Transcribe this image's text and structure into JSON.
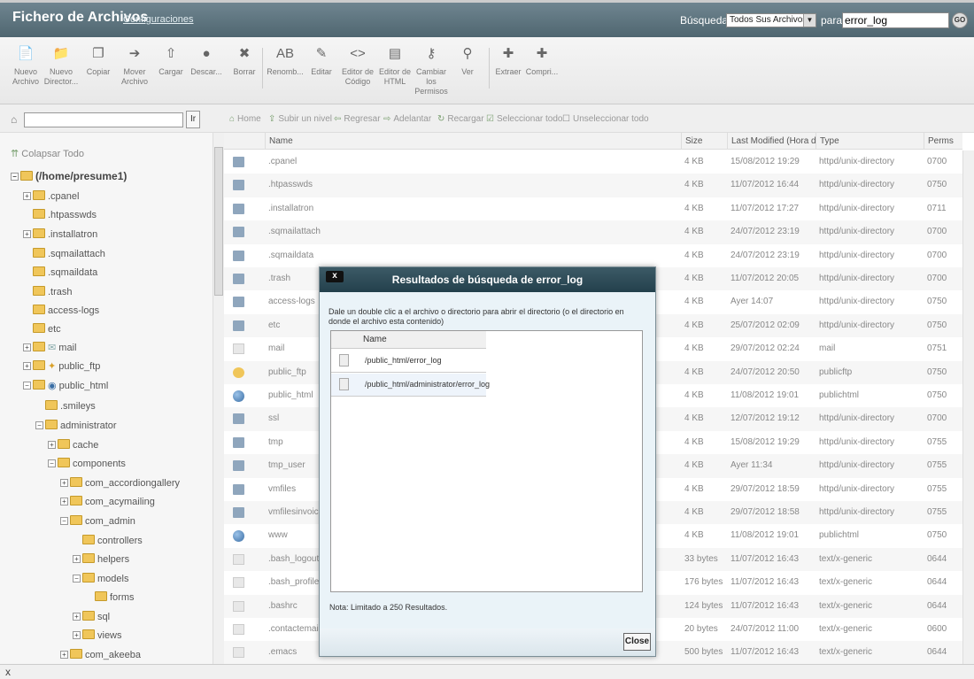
{
  "header": {
    "title": "Fichero de Archivos",
    "config_link": "Configuraciones",
    "search_label": "Búsqueda",
    "search_scope": "Todos Sus Archivos",
    "para_label": "para",
    "search_value": "error_log",
    "go_label": "GO"
  },
  "toolbar": {
    "items": [
      {
        "label": "Nuevo\nArchivo"
      },
      {
        "label": "Nuevo\nDirector..."
      },
      {
        "label": "Copiar"
      },
      {
        "label": "Mover\nArchivo"
      },
      {
        "label": "Cargar"
      },
      {
        "label": "Descar..."
      },
      {
        "label": "Borrar"
      },
      {
        "label": "Renomb..."
      },
      {
        "label": "Editar"
      },
      {
        "label": "Editor de\nCódigo"
      },
      {
        "label": "Editor de\nHTML"
      },
      {
        "label": "Cambiar\nlos\nPermisos"
      },
      {
        "label": "Ver"
      },
      {
        "label": "Extraer"
      },
      {
        "label": "Compri..."
      }
    ]
  },
  "pathbar": {
    "go_label": "Ir",
    "home": "Home",
    "up": "Subir un nivel",
    "back": "Regresar",
    "forward": "Adelantar",
    "reload": "Recargar",
    "select_all": "Seleccionar todo",
    "unselect_all": "Unseleccionar todo"
  },
  "tree": {
    "collapse": "Colapsar Todo",
    "root": "(/home/presume1)",
    "nodes": [
      ".cpanel",
      ".htpasswds",
      ".installatron",
      ".sqmailattach",
      ".sqmaildata",
      ".trash",
      "access-logs",
      "etc",
      "mail",
      "public_ftp",
      "public_html",
      ".smileys",
      "administrator",
      "cache",
      "components",
      "com_accordiongallery",
      "com_acymailing",
      "com_admin",
      "controllers",
      "helpers",
      "models",
      "forms",
      "sql",
      "views",
      "com_akeeba"
    ]
  },
  "table": {
    "columns": [
      "Name",
      "Size",
      "Last Modified (Hora de ve",
      "Type",
      "Perms"
    ],
    "rows": [
      {
        "name": ".cpanel",
        "size": "4 KB",
        "modified": "15/08/2012 19:29",
        "type": "httpd/unix-directory",
        "perms": "0700"
      },
      {
        "name": ".htpasswds",
        "size": "4 KB",
        "modified": "11/07/2012 16:44",
        "type": "httpd/unix-directory",
        "perms": "0750"
      },
      {
        "name": ".installatron",
        "size": "4 KB",
        "modified": "11/07/2012 17:27",
        "type": "httpd/unix-directory",
        "perms": "0711"
      },
      {
        "name": ".sqmailattach",
        "size": "4 KB",
        "modified": "24/07/2012 23:19",
        "type": "httpd/unix-directory",
        "perms": "0700"
      },
      {
        "name": ".sqmaildata",
        "size": "4 KB",
        "modified": "24/07/2012 23:19",
        "type": "httpd/unix-directory",
        "perms": "0700"
      },
      {
        "name": ".trash",
        "size": "4 KB",
        "modified": "11/07/2012 20:05",
        "type": "httpd/unix-directory",
        "perms": "0700"
      },
      {
        "name": "access-logs",
        "size": "4 KB",
        "modified": "Ayer 14:07",
        "type": "httpd/unix-directory",
        "perms": "0750"
      },
      {
        "name": "etc",
        "size": "4 KB",
        "modified": "25/07/2012 02:09",
        "type": "httpd/unix-directory",
        "perms": "0750"
      },
      {
        "name": "mail",
        "size": "4 KB",
        "modified": "29/07/2012 02:24",
        "type": "mail",
        "perms": "0751"
      },
      {
        "name": "public_ftp",
        "size": "4 KB",
        "modified": "24/07/2012 20:50",
        "type": "publicftp",
        "perms": "0750"
      },
      {
        "name": "public_html",
        "size": "4 KB",
        "modified": "11/08/2012 19:01",
        "type": "publichtml",
        "perms": "0750"
      },
      {
        "name": "ssl",
        "size": "4 KB",
        "modified": "12/07/2012 19:12",
        "type": "httpd/unix-directory",
        "perms": "0700"
      },
      {
        "name": "tmp",
        "size": "4 KB",
        "modified": "15/08/2012 19:29",
        "type": "httpd/unix-directory",
        "perms": "0755"
      },
      {
        "name": "tmp_user",
        "size": "4 KB",
        "modified": "Ayer 11:34",
        "type": "httpd/unix-directory",
        "perms": "0755"
      },
      {
        "name": "vmfiles",
        "size": "4 KB",
        "modified": "29/07/2012 18:59",
        "type": "httpd/unix-directory",
        "perms": "0755"
      },
      {
        "name": "vmfilesinvoices",
        "size": "4 KB",
        "modified": "29/07/2012 18:58",
        "type": "httpd/unix-directory",
        "perms": "0755"
      },
      {
        "name": "www",
        "size": "4 KB",
        "modified": "11/08/2012 19:01",
        "type": "publichtml",
        "perms": "0750"
      },
      {
        "name": ".bash_logout",
        "size": "33 bytes",
        "modified": "11/07/2012 16:43",
        "type": "text/x-generic",
        "perms": "0644"
      },
      {
        "name": ".bash_profile",
        "size": "176 bytes",
        "modified": "11/07/2012 16:43",
        "type": "text/x-generic",
        "perms": "0644"
      },
      {
        "name": ".bashrc",
        "size": "124 bytes",
        "modified": "11/07/2012 16:43",
        "type": "text/x-generic",
        "perms": "0644"
      },
      {
        "name": ".contactemail",
        "size": "20 bytes",
        "modified": "24/07/2012 11:00",
        "type": "text/x-generic",
        "perms": "0600"
      },
      {
        "name": ".emacs",
        "size": "500 bytes",
        "modified": "11/07/2012 16:43",
        "type": "text/x-generic",
        "perms": "0644"
      }
    ]
  },
  "dialog": {
    "title": "Resultados de búsqueda de error_log",
    "close_x": "x",
    "description": "Dale un double clic a el archivo o directorio para abrir el directorio (o el directorio en donde el archivo esta contenido)",
    "column": "Name",
    "results": [
      "/public_html/error_log",
      "/public_html/administrator/error_log"
    ],
    "note": "Nota: Limitado a 250 Resultados.",
    "close_button": "Close"
  },
  "status": {
    "text": "x"
  }
}
